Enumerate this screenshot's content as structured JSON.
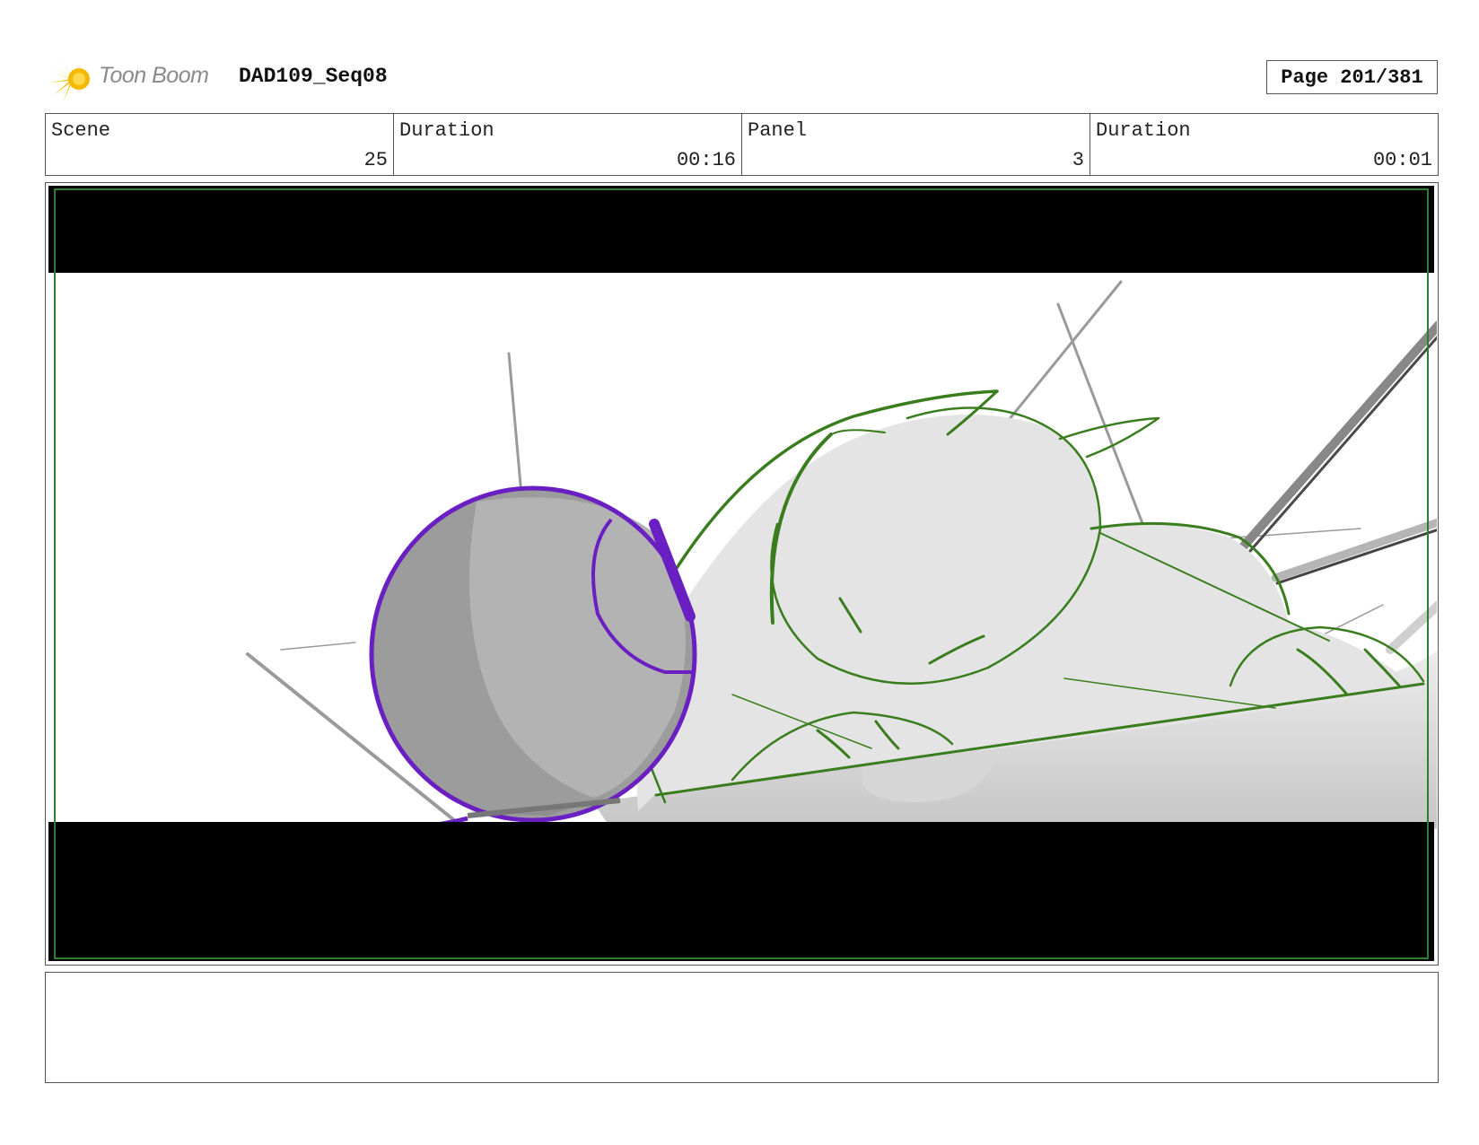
{
  "header": {
    "logo_text": "Toon Boom",
    "project_title": "DAD109_Seq08",
    "page_label": "Page 201/381"
  },
  "info": [
    {
      "label": "Scene",
      "value": "25"
    },
    {
      "label": "Duration",
      "value": "00:16"
    },
    {
      "label": "Panel",
      "value": "3"
    },
    {
      "label": "Duration",
      "value": "00:01"
    }
  ],
  "panel": {
    "letterbox_color": "#000000",
    "safe_frame_color": "#2e7d32",
    "helmet_outline_color": "#6a1fc2",
    "character_line_color": "#3a7d1e"
  },
  "icons": {
    "logo": "toon-boom-starburst-icon"
  },
  "notes": ""
}
